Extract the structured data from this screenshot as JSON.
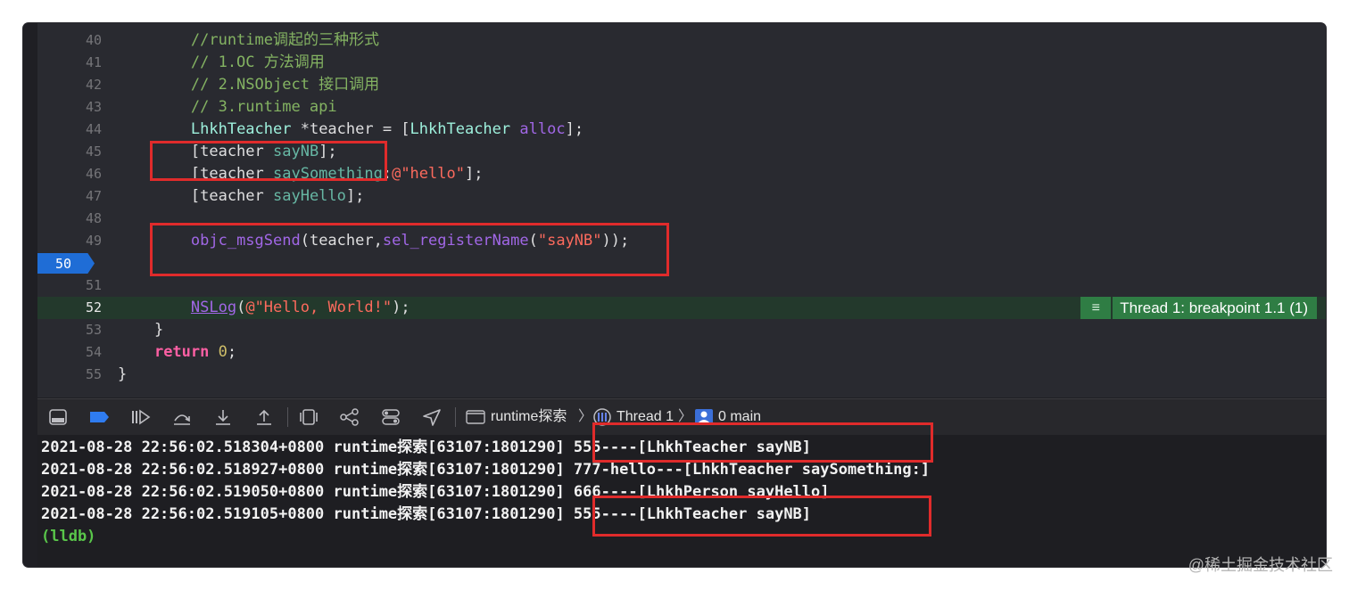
{
  "editor": {
    "lines": [
      {
        "n": "40",
        "parts": [
          {
            "t": "        //runtime调起的三种形式",
            "c": "comment"
          }
        ]
      },
      {
        "n": "41",
        "parts": [
          {
            "t": "        // 1.OC 方法调用",
            "c": "comment"
          }
        ]
      },
      {
        "n": "42",
        "parts": [
          {
            "t": "        // 2.NSObject 接口调用",
            "c": "comment"
          }
        ]
      },
      {
        "n": "43",
        "parts": [
          {
            "t": "        // 3.runtime api",
            "c": "comment"
          }
        ]
      },
      {
        "n": "44",
        "parts": [
          {
            "t": "        ",
            "c": ""
          },
          {
            "t": "LhkhTeacher",
            "c": "cls"
          },
          {
            "t": " *teacher = [",
            "c": ""
          },
          {
            "t": "LhkhTeacher",
            "c": "cls"
          },
          {
            "t": " ",
            "c": ""
          },
          {
            "t": "alloc",
            "c": "fn"
          },
          {
            "t": "];",
            "c": ""
          }
        ]
      },
      {
        "n": "45",
        "parts": [
          {
            "t": "        [teacher ",
            "c": ""
          },
          {
            "t": "sayNB",
            "c": "meth"
          },
          {
            "t": "];",
            "c": ""
          }
        ]
      },
      {
        "n": "46",
        "parts": [
          {
            "t": "        [teacher ",
            "c": ""
          },
          {
            "t": "saySomething",
            "c": "meth"
          },
          {
            "t": ":",
            "c": ""
          },
          {
            "t": "@\"hello\"",
            "c": "str"
          },
          {
            "t": "];",
            "c": ""
          }
        ]
      },
      {
        "n": "47",
        "parts": [
          {
            "t": "        [teacher ",
            "c": ""
          },
          {
            "t": "sayHello",
            "c": "meth"
          },
          {
            "t": "];",
            "c": ""
          }
        ]
      },
      {
        "n": "48",
        "parts": []
      },
      {
        "n": "49",
        "parts": [
          {
            "t": "        ",
            "c": ""
          },
          {
            "t": "objc_msgSend",
            "c": "fn"
          },
          {
            "t": "(teacher,",
            "c": ""
          },
          {
            "t": "sel_registerName",
            "c": "fn"
          },
          {
            "t": "(",
            "c": ""
          },
          {
            "t": "\"sayNB\"",
            "c": "str"
          },
          {
            "t": "));",
            "c": ""
          }
        ]
      },
      {
        "n": "50",
        "parts": [],
        "breakpoint": true
      },
      {
        "n": "51",
        "parts": []
      },
      {
        "n": "52",
        "parts": [
          {
            "t": "        ",
            "c": ""
          },
          {
            "t": "NSLog",
            "c": "fn ul"
          },
          {
            "t": "(",
            "c": ""
          },
          {
            "t": "@\"Hello, World!\"",
            "c": "str"
          },
          {
            "t": ");",
            "c": ""
          }
        ],
        "current": true
      },
      {
        "n": "53",
        "parts": [
          {
            "t": "    }",
            "c": ""
          }
        ]
      },
      {
        "n": "54",
        "parts": [
          {
            "t": "    ",
            "c": ""
          },
          {
            "t": "return",
            "c": "kw"
          },
          {
            "t": " ",
            "c": ""
          },
          {
            "t": "0",
            "c": "num"
          },
          {
            "t": ";",
            "c": ""
          }
        ]
      },
      {
        "n": "55",
        "parts": [
          {
            "t": "}",
            "c": ""
          }
        ]
      }
    ],
    "thread_badge": "Thread 1: breakpoint 1.1 (1)"
  },
  "toolbar": {
    "target": "runtime探索",
    "thread": "Thread 1",
    "frame": "0 main"
  },
  "console": {
    "lines": [
      "2021-08-28 22:56:02.518304+0800 runtime探索[63107:1801290] 555----[LhkhTeacher sayNB]",
      "2021-08-28 22:56:02.518927+0800 runtime探索[63107:1801290] 777-hello---[LhkhTeacher saySomething:]",
      "2021-08-28 22:56:02.519050+0800 runtime探索[63107:1801290] 666----[LhkhPerson sayHello]",
      "2021-08-28 22:56:02.519105+0800 runtime探索[63107:1801290] 555----[LhkhTeacher sayNB]"
    ],
    "prompt": "(lldb)"
  },
  "watermark": "@稀土掘金技术社区",
  "colors": {
    "breakpoint": "#1f6dd6",
    "current_line": "#23392c",
    "annotation_box": "#e02b2b"
  }
}
